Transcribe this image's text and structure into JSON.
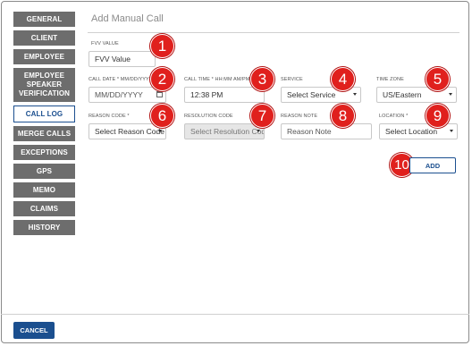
{
  "sidebar": {
    "items": [
      {
        "label": "GENERAL"
      },
      {
        "label": "CLIENT"
      },
      {
        "label": "EMPLOYEE"
      },
      {
        "label": "EMPLOYEE SPEAKER VERIFICATION"
      },
      {
        "label": "CALL LOG"
      },
      {
        "label": "MERGE CALLS"
      },
      {
        "label": "EXCEPTIONS"
      },
      {
        "label": "GPS"
      },
      {
        "label": "MEMO"
      },
      {
        "label": "CLAIMS"
      },
      {
        "label": "HISTORY"
      }
    ],
    "active": "CALL LOG"
  },
  "page": {
    "title": "Add Manual Call"
  },
  "form": {
    "fvv_value": {
      "label": "FVV VALUE",
      "value": "FVV Value"
    },
    "call_date": {
      "label": "CALL DATE * MM/DD/YYYY",
      "placeholder": "MM/DD/YYYY"
    },
    "call_time": {
      "label": "CALL TIME * HH:MM AM/PM",
      "value": "12:38 PM"
    },
    "service": {
      "label": "SERVICE",
      "value": "Select Service"
    },
    "time_zone": {
      "label": "TIME ZONE",
      "value": "US/Eastern"
    },
    "reason_code": {
      "label": "REASON CODE *",
      "value": "Select Reason Code"
    },
    "resolution_code": {
      "label": "RESOLUTION CODE",
      "value": "Select Resolution Code"
    },
    "reason_note": {
      "label": "REASON NOTE",
      "placeholder": "Reason Note"
    },
    "location": {
      "label": "LOCATION *",
      "value": "Select Location"
    }
  },
  "badges": [
    "1",
    "2",
    "3",
    "4",
    "5",
    "6",
    "7",
    "8",
    "9",
    "10"
  ],
  "buttons": {
    "add": "ADD",
    "cancel": "CANCEL"
  },
  "colors": {
    "accent": "#1b4f8f",
    "sidebar_bg": "#6d6d6d",
    "badge": "#e0201d"
  }
}
